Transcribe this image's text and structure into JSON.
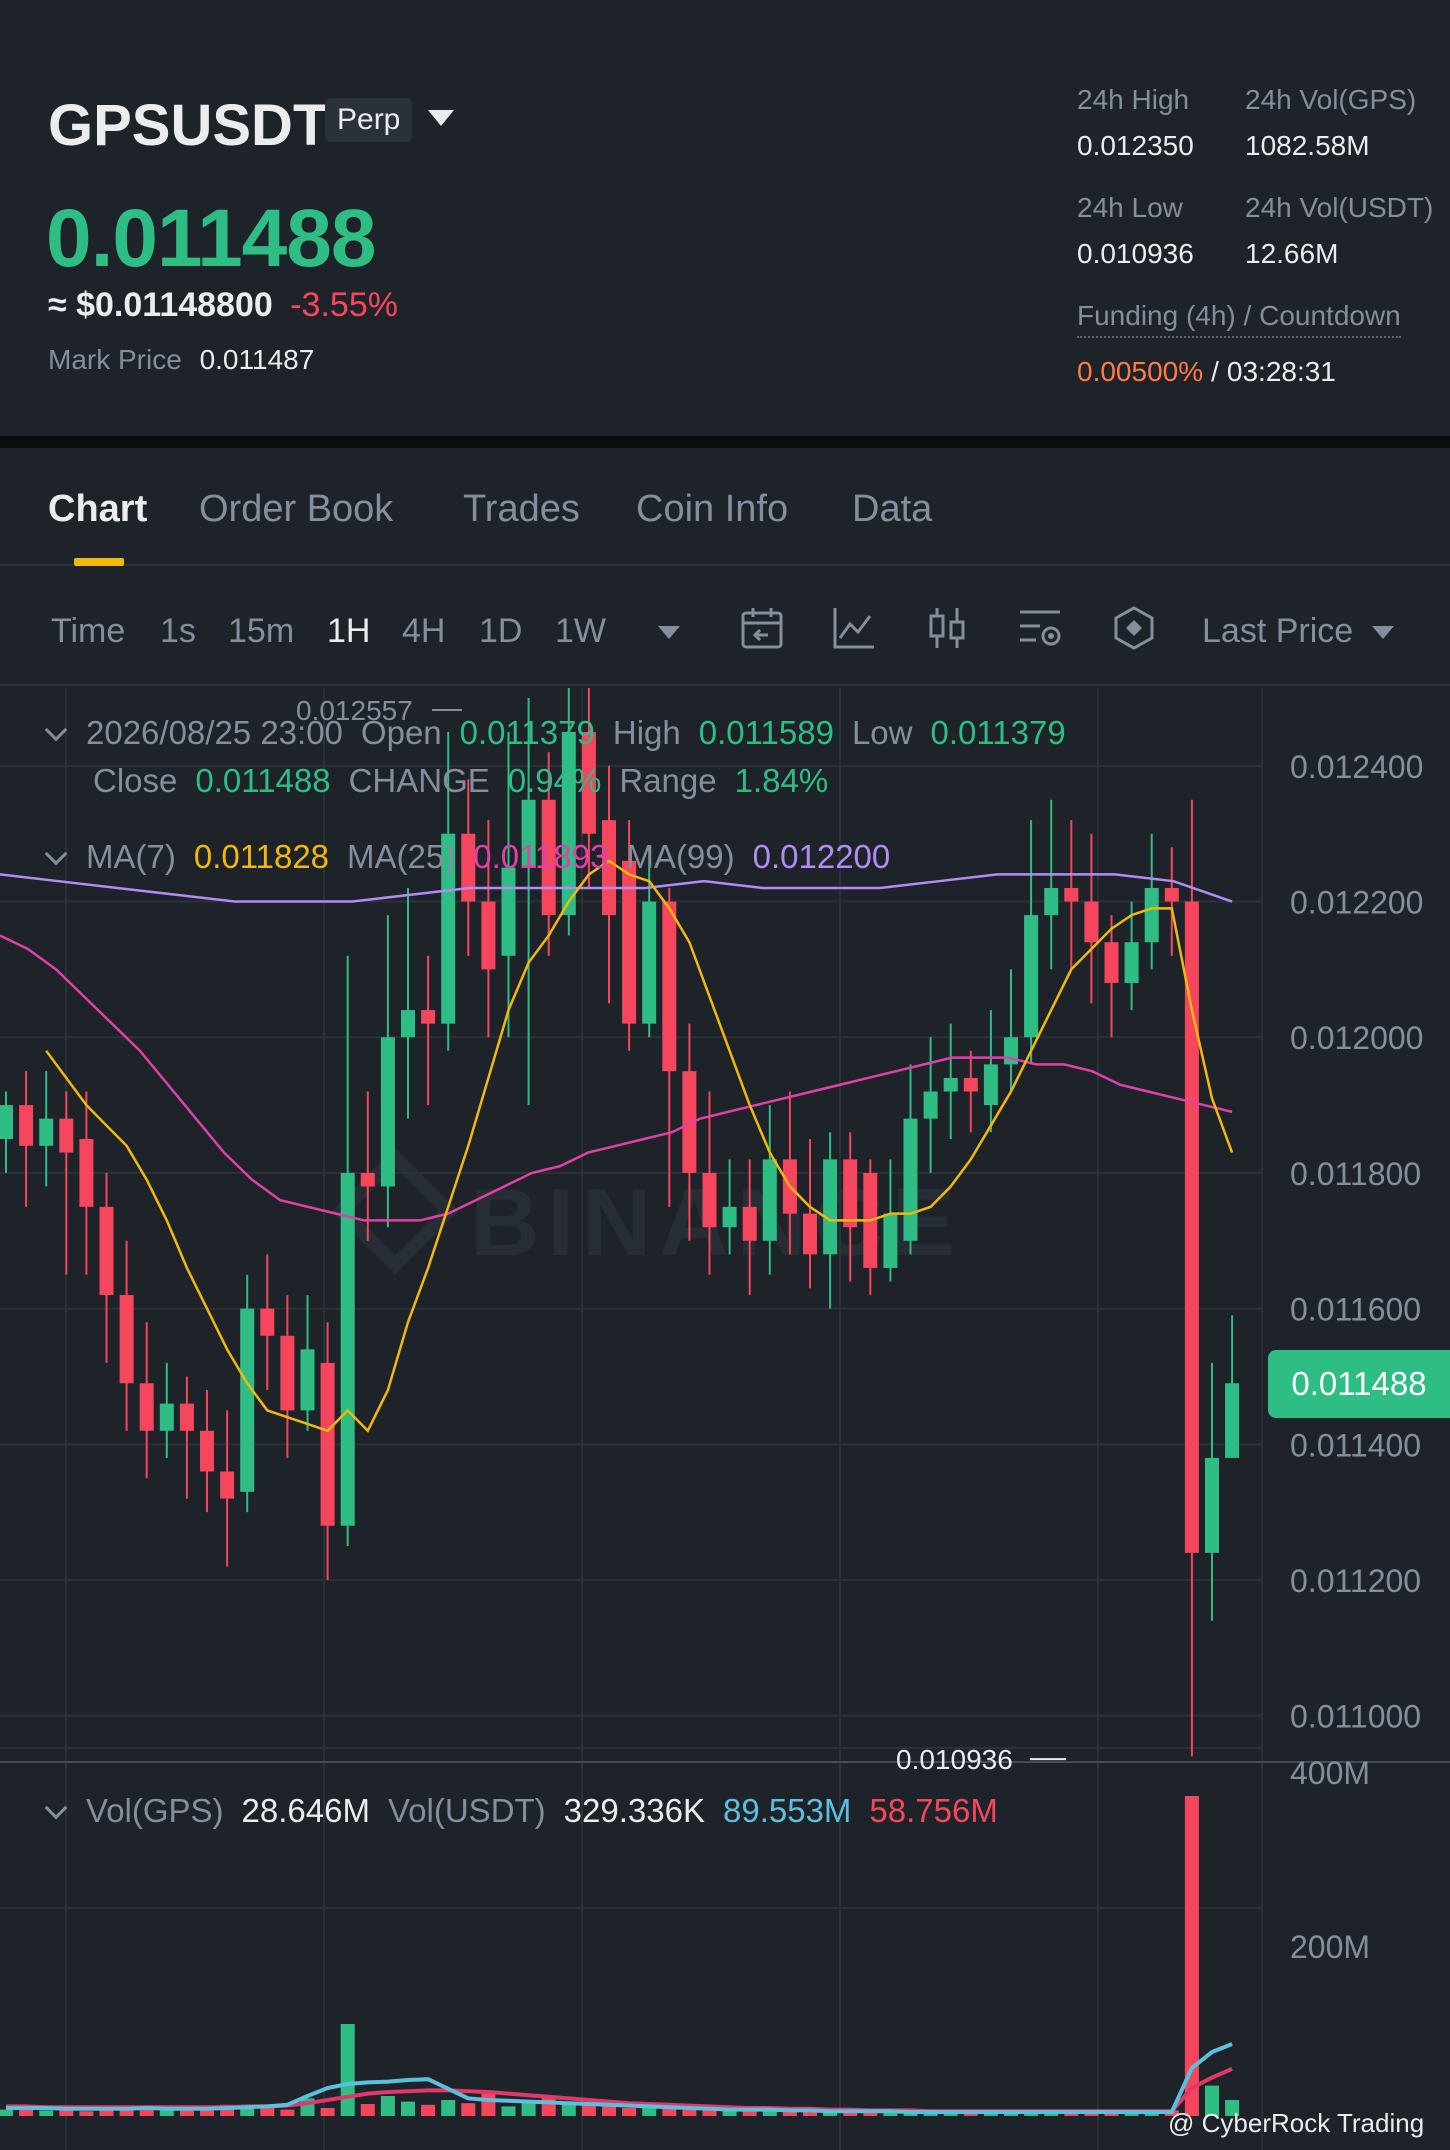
{
  "header": {
    "symbol": "GPSUSDT",
    "contract_badge": "Perp",
    "last_price": "0.011488",
    "fiat_price": "≈ $0.01148800",
    "change_pct": "-3.55%",
    "mark_price_label": "Mark Price",
    "mark_price": "0.011487",
    "high_label": "24h High",
    "high": "0.012350",
    "vol_base_label": "24h Vol(GPS)",
    "vol_base": "1082.58M",
    "low_label": "24h Low",
    "low": "0.010936",
    "vol_quote_label": "24h Vol(USDT)",
    "vol_quote": "12.66M",
    "funding_label": "Funding (4h) / Countdown",
    "funding_rate": "0.00500%",
    "funding_sep": "/",
    "countdown": "03:28:31"
  },
  "tabs": [
    {
      "label": "Chart",
      "active": true
    },
    {
      "label": "Order Book"
    },
    {
      "label": "Trades"
    },
    {
      "label": "Coin Info"
    },
    {
      "label": "Data"
    }
  ],
  "toolbar": {
    "timeframes": [
      "Time",
      "1s",
      "15m",
      "1H",
      "4H",
      "1D",
      "1W"
    ],
    "active_timeframe": "1H",
    "icons": [
      "calendar-icon",
      "line-chart-icon",
      "candlestick-icon",
      "chart-settings-icon",
      "indicator-icon"
    ],
    "price_type": "Last Price"
  },
  "ohlc": {
    "datetime": "2026/08/25 23:00",
    "open_label": "Open",
    "open": "0.011379",
    "high_label": "High",
    "high": "0.011589",
    "low_label": "Low",
    "low": "0.011379",
    "close_label": "Close",
    "close": "0.011488",
    "change_label": "CHANGE",
    "change": "0.94%",
    "range_label": "Range",
    "range": "1.84%"
  },
  "ma": {
    "ma7_label": "MA(7)",
    "ma7": "0.011828",
    "ma25_label": "MA(25)",
    "ma25": "0.011893",
    "ma99_label": "MA(99)",
    "ma99": "0.012200"
  },
  "volume": {
    "vol_base_label": "Vol(GPS)",
    "vol_base": "28.646M",
    "vol_quote_label": "Vol(USDT)",
    "vol_quote": "329.336K",
    "ma5": "89.553M",
    "ma10": "58.756M"
  },
  "colors": {
    "up": "#2ebd85",
    "down": "#f6465d",
    "ma7": "#f0b90b",
    "ma25": "#e040a8",
    "ma99": "#b18cf4",
    "vol_ma5": "#5bc0de",
    "vol_ma10": "#e0386a",
    "accent": "#f0b90b"
  },
  "watermark": "BINANCE",
  "credit": "@ CyberRock Trading",
  "chart_data": {
    "type": "candlestick",
    "interval": "1H",
    "price_axis": {
      "ticks": [
        "0.012400",
        "0.012200",
        "0.012000",
        "0.011800",
        "0.011600",
        "0.011400",
        "0.011200",
        "0.011000"
      ],
      "ylim": [
        0.01092,
        0.0125
      ]
    },
    "volume_axis": {
      "ticks": [
        "400M",
        "200M"
      ]
    },
    "current_price": "0.011488",
    "high_marker": "0.012557",
    "low_marker": "0.010936",
    "candles": [
      [
        0.01185,
        0.0119,
        0.01192,
        0.0118
      ],
      [
        0.0119,
        0.01184,
        0.01195,
        0.01175
      ],
      [
        0.01184,
        0.01188,
        0.01195,
        0.01178
      ],
      [
        0.01188,
        0.01183,
        0.01192,
        0.01165
      ],
      [
        0.01185,
        0.01175,
        0.01192,
        0.01165
      ],
      [
        0.01175,
        0.01162,
        0.0118,
        0.01152
      ],
      [
        0.01162,
        0.01149,
        0.0117,
        0.01142
      ],
      [
        0.01149,
        0.01142,
        0.01158,
        0.01135
      ],
      [
        0.01142,
        0.01146,
        0.01152,
        0.01138
      ],
      [
        0.01146,
        0.01142,
        0.0115,
        0.01132
      ],
      [
        0.01142,
        0.01136,
        0.01148,
        0.0113
      ],
      [
        0.01136,
        0.01132,
        0.01145,
        0.01122
      ],
      [
        0.01133,
        0.0116,
        0.01165,
        0.0113
      ],
      [
        0.0116,
        0.01156,
        0.01168,
        0.01148
      ],
      [
        0.01156,
        0.01145,
        0.01162,
        0.01138
      ],
      [
        0.01145,
        0.01154,
        0.01162,
        0.01142
      ],
      [
        0.01152,
        0.01128,
        0.01158,
        0.0112
      ],
      [
        0.01128,
        0.0118,
        0.01212,
        0.01125
      ],
      [
        0.0118,
        0.01178,
        0.01192,
        0.0117
      ],
      [
        0.01178,
        0.012,
        0.01218,
        0.01172
      ],
      [
        0.012,
        0.01204,
        0.01222,
        0.01188
      ],
      [
        0.01204,
        0.01202,
        0.01212,
        0.0119
      ],
      [
        0.01202,
        0.0123,
        0.01245,
        0.01198
      ],
      [
        0.0123,
        0.0122,
        0.01238,
        0.01212
      ],
      [
        0.0122,
        0.0121,
        0.01232,
        0.012
      ],
      [
        0.01212,
        0.01225,
        0.01245,
        0.012
      ],
      [
        0.01225,
        0.01235,
        0.0125,
        0.0119
      ],
      [
        0.01235,
        0.01218,
        0.01242,
        0.01212
      ],
      [
        0.01218,
        0.01245,
        0.01252,
        0.01215
      ],
      [
        0.01245,
        0.0123,
        0.01255,
        0.01222
      ],
      [
        0.01232,
        0.01218,
        0.0124,
        0.01205
      ],
      [
        0.01226,
        0.01202,
        0.01232,
        0.01198
      ],
      [
        0.01202,
        0.0122,
        0.01228,
        0.012
      ],
      [
        0.0122,
        0.01195,
        0.01222,
        0.01175
      ],
      [
        0.01195,
        0.0118,
        0.01202,
        0.0117
      ],
      [
        0.0118,
        0.01172,
        0.01192,
        0.01165
      ],
      [
        0.01172,
        0.01175,
        0.01182,
        0.01168
      ],
      [
        0.01175,
        0.0117,
        0.01182,
        0.01162
      ],
      [
        0.0117,
        0.01182,
        0.0119,
        0.01165
      ],
      [
        0.01182,
        0.01174,
        0.01192,
        0.01168
      ],
      [
        0.01174,
        0.01168,
        0.01185,
        0.01163
      ],
      [
        0.01168,
        0.01182,
        0.01186,
        0.0116
      ],
      [
        0.01182,
        0.01172,
        0.01186,
        0.01164
      ],
      [
        0.0118,
        0.01166,
        0.01182,
        0.01162
      ],
      [
        0.01166,
        0.01174,
        0.01182,
        0.01164
      ],
      [
        0.0117,
        0.01188,
        0.01196,
        0.01168
      ],
      [
        0.01188,
        0.01192,
        0.012,
        0.0118
      ],
      [
        0.01192,
        0.01194,
        0.01202,
        0.01185
      ],
      [
        0.01194,
        0.01192,
        0.01198,
        0.01186
      ],
      [
        0.0119,
        0.01196,
        0.01204,
        0.01186
      ],
      [
        0.01196,
        0.012,
        0.0121,
        0.01192
      ],
      [
        0.012,
        0.01218,
        0.01232,
        0.01196
      ],
      [
        0.01218,
        0.01222,
        0.01235,
        0.0121
      ],
      [
        0.01222,
        0.0122,
        0.01232,
        0.0121
      ],
      [
        0.0122,
        0.01214,
        0.0123,
        0.01205
      ],
      [
        0.01214,
        0.01208,
        0.01218,
        0.012
      ],
      [
        0.01208,
        0.01214,
        0.0122,
        0.01204
      ],
      [
        0.01214,
        0.01222,
        0.0123,
        0.0121
      ],
      [
        0.01222,
        0.0122,
        0.01228,
        0.01212
      ],
      [
        0.0122,
        0.01124,
        0.01235,
        0.01094
      ],
      [
        0.01124,
        0.01138,
        0.01152,
        0.01114
      ],
      [
        0.01138,
        0.01149,
        0.01159,
        0.01138
      ]
    ],
    "ma7": [
      0.01198,
      0.01194,
      0.0119,
      0.01187,
      0.01184,
      0.01179,
      0.01173,
      0.01166,
      0.0116,
      0.01154,
      0.01149,
      0.01145,
      0.01144,
      0.01143,
      0.01142,
      0.01145,
      0.01142,
      0.01148,
      0.01158,
      0.01166,
      0.01175,
      0.01184,
      0.01194,
      0.01204,
      0.01211,
      0.01215,
      0.0122,
      0.01224,
      0.01226,
      0.01224,
      0.01223,
      0.01219,
      0.01214,
      0.01206,
      0.01198,
      0.0119,
      0.01183,
      0.01178,
      0.01175,
      0.01173,
      0.01173,
      0.01173,
      0.01174,
      0.01174,
      0.01175,
      0.01178,
      0.01182,
      0.01187,
      0.01192,
      0.01198,
      0.01204,
      0.0121,
      0.01213,
      0.01216,
      0.01218,
      0.01219,
      0.01219,
      0.01204,
      0.01191,
      0.01183
    ],
    "ma25": [
      0.01215,
      0.01213,
      0.0121,
      0.01206,
      0.01202,
      0.01198,
      0.01193,
      0.01188,
      0.01183,
      0.01179,
      0.01176,
      0.01175,
      0.01174,
      0.01173,
      0.01173,
      0.01173,
      0.01174,
      0.01176,
      0.01178,
      0.0118,
      0.01181,
      0.01183,
      0.01184,
      0.01185,
      0.01186,
      0.01188,
      0.01189,
      0.0119,
      0.01191,
      0.01192,
      0.01193,
      0.01194,
      0.01195,
      0.01196,
      0.01197,
      0.01197,
      0.01197,
      0.01196,
      0.01196,
      0.01195,
      0.01193,
      0.01192,
      0.01191,
      0.0119,
      0.01189
    ],
    "ma99": [
      0.01224,
      0.01223,
      0.01222,
      0.01221,
      0.0122,
      0.0122,
      0.0122,
      0.01221,
      0.01222,
      0.01222,
      0.01222,
      0.01222,
      0.01223,
      0.01222,
      0.01222,
      0.01222,
      0.01223,
      0.01224,
      0.01224,
      0.01224,
      0.01223,
      0.0122
    ],
    "volumes": [
      8,
      10,
      7,
      9,
      6,
      12,
      10,
      8,
      9,
      7,
      11,
      14,
      10,
      12,
      8,
      22,
      10,
      115,
      15,
      25,
      18,
      14,
      20,
      16,
      30,
      12,
      18,
      25,
      14,
      16,
      12,
      10,
      14,
      12,
      9,
      10,
      8,
      9,
      7,
      8,
      6,
      7,
      6,
      5,
      6,
      5,
      4,
      5,
      5,
      4,
      6,
      5,
      6,
      5,
      4,
      5,
      5,
      6,
      7,
      400,
      38,
      20
    ],
    "vol_ma5": [
      10,
      10,
      10,
      9,
      9,
      9,
      9,
      10,
      9,
      9,
      9,
      10,
      11,
      12,
      14,
      25,
      35,
      40,
      42,
      43,
      45,
      46,
      34,
      22,
      20,
      19,
      18,
      17,
      16,
      15,
      14,
      13,
      12,
      11,
      10,
      9,
      8,
      8,
      8,
      7,
      7,
      6,
      6,
      6,
      6,
      5,
      5,
      5,
      5,
      5,
      5,
      5,
      5,
      5,
      5,
      5,
      5,
      5,
      5,
      60,
      80,
      90
    ],
    "vol_ma10": [
      12,
      12,
      11,
      11,
      11,
      11,
      11,
      11,
      11,
      11,
      11,
      11,
      12,
      12,
      13,
      16,
      20,
      24,
      28,
      30,
      31,
      32,
      32,
      31,
      30,
      28,
      26,
      24,
      22,
      20,
      18,
      16,
      15,
      14,
      13,
      12,
      11,
      10,
      10,
      9,
      9,
      8,
      8,
      7,
      7,
      7,
      6,
      6,
      6,
      6,
      6,
      6,
      6,
      6,
      6,
      6,
      6,
      6,
      6,
      35,
      48,
      59
    ]
  }
}
